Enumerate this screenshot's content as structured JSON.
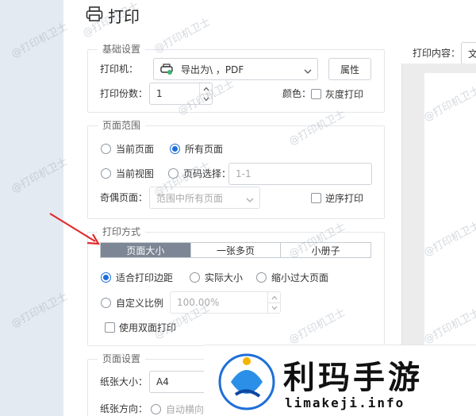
{
  "window": {
    "title": "打印"
  },
  "watermark": "@打印机卫士",
  "basic": {
    "legend": "基础设置",
    "printer_label": "打印机：",
    "printer_value": "导出为\\ ，PDF",
    "properties_button": "属性",
    "copies_label": "打印份数：",
    "copies_value": "1",
    "color_label": "颜色：",
    "grayscale_label": "灰度打印"
  },
  "range": {
    "legend": "页面范围",
    "current_page": "当前页面",
    "all_pages": "所有页面",
    "current_view": "当前视图",
    "page_select": "页码选择：",
    "page_select_placeholder": "1-1",
    "odd_even_label": "奇偶页面：",
    "odd_even_value": "范围中所有页面",
    "reverse_label": "逆序打印"
  },
  "mode": {
    "legend": "打印方式",
    "tabs": [
      "页面大小",
      "一张多页",
      "小册子"
    ],
    "fit_margin": "适合打印边距",
    "actual_size": "实际大小",
    "shrink": "缩小过大页面",
    "custom_scale": "自定义比例",
    "custom_scale_value": "100.00%",
    "duplex": "使用双面打印"
  },
  "page_setup": {
    "legend": "页面设置",
    "paper_size_label": "纸张大小：",
    "paper_size_value": "A4",
    "orientation_label": "纸张方向：",
    "auto_orient": "自动横向"
  },
  "preview": {
    "content_label": "打印内容：",
    "content_value": "文"
  },
  "ad": {
    "name": "利玛手游",
    "url": "limakeji.info"
  }
}
